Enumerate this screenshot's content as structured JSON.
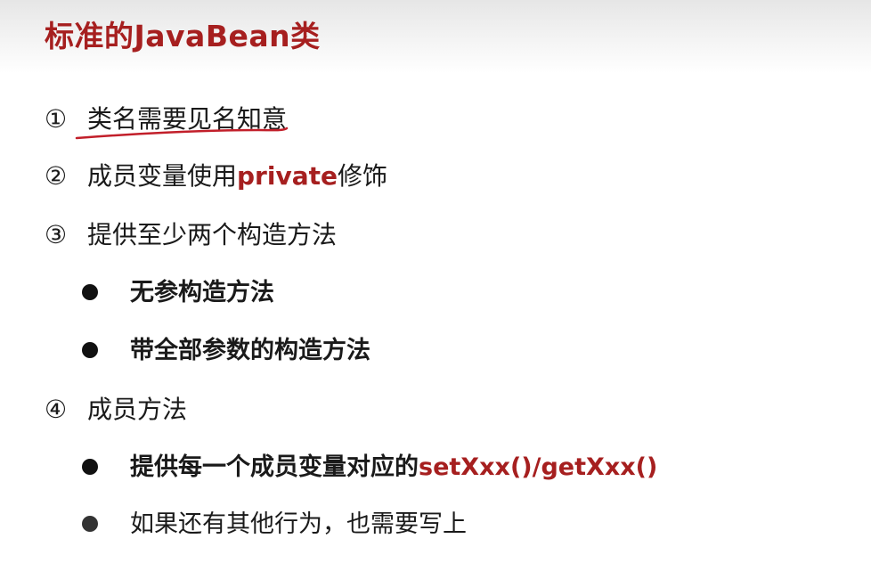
{
  "title": "标准的JavaBean类",
  "items": [
    {
      "num": "①",
      "text": "类名需要见名知意"
    },
    {
      "num": "②",
      "text_before": "成员变量使用",
      "highlight": "private",
      "text_after": "修饰"
    },
    {
      "num": "③",
      "text": "提供至少两个构造方法"
    },
    {
      "num": "④",
      "text": "成员方法"
    }
  ],
  "constructors": [
    "无参构造方法",
    "带全部参数的构造方法"
  ],
  "methods": [
    {
      "text": "提供每一个成员变量对应的",
      "highlight": "setXxx()/getXxx()"
    },
    {
      "text": "如果还有其他行为，也需要写上"
    }
  ],
  "colors": {
    "accent": "#a61f1f",
    "text": "#1a1a1a",
    "underline": "#c21f2a"
  }
}
